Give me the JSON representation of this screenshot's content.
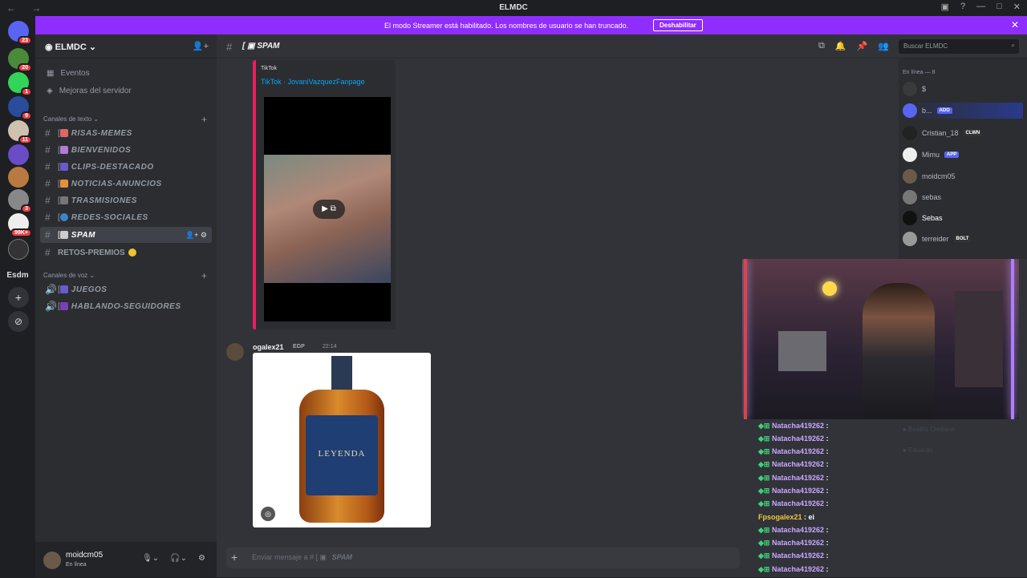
{
  "titlebar": {
    "title": "ELMDC"
  },
  "banner": {
    "text": "El modo Streamer está habilitado. Los nombres de usuario se han truncado.",
    "button": "Deshabilitar"
  },
  "servers": {
    "badges": [
      "23",
      "20",
      "1",
      "9",
      "11",
      "3",
      "99K+"
    ],
    "label": "Esdm"
  },
  "sidebar": {
    "guild_name": "ELMDC",
    "shortcuts": [
      "Eventos",
      "Mejoras del servidor"
    ],
    "text_category": "Canales de texto",
    "channels": [
      "RISAS-MEMES",
      "BIENVENIDOS",
      "CLIPS-DESTACADO",
      "NOTICIAS-ANUNCIOS",
      "TRASMISIONES",
      "REDES-SOCIALES",
      "SPAM",
      "RETOS-PREMIOS"
    ],
    "voice_category": "Canales de voz",
    "voice_channels": [
      "JUEGOS",
      "HABLANDO-SEGUIDORES"
    ]
  },
  "user": {
    "name": "moidcm05",
    "status": "En línea"
  },
  "channel": {
    "name": "SPAM",
    "search_placeholder": "Buscar ELMDC"
  },
  "embed": {
    "provider": "TikTok",
    "title": "TikTok · JovaniVazquezFanpage"
  },
  "message": {
    "author": "ogalex21",
    "tag": "EGP",
    "time": "22:14",
    "product_text": "LEYENDA"
  },
  "composer": {
    "placeholder": "Enviar mensaje a #",
    "channel": "SPAM"
  },
  "members": {
    "header": "En línea — 8",
    "list": [
      {
        "name": "$",
        "badge": ""
      },
      {
        "name": "b...",
        "badge": "ADO"
      },
      {
        "name": "Cristian_18",
        "badge": "CLWN"
      },
      {
        "name": "Mimu",
        "badge": "APP"
      },
      {
        "name": "moidcm05",
        "badge": ""
      },
      {
        "name": "sebas",
        "badge": ""
      },
      {
        "name": "Sebas",
        "badge": ""
      },
      {
        "name": "terreider",
        "badge": "BOLT"
      }
    ]
  },
  "chat": {
    "lines": [
      {
        "user": "Natacha419262",
        "text": ":"
      },
      {
        "user": "Natacha419262",
        "text": ":"
      },
      {
        "user": "Natacha419262",
        "text": ":"
      },
      {
        "user": "Natacha419262",
        "text": ":"
      },
      {
        "user": "Natacha419262",
        "text": ":"
      },
      {
        "user": "Natacha419262",
        "text": ":"
      },
      {
        "user": "Natacha419262",
        "text": ":"
      },
      {
        "user": "Fpsogalex21",
        "text": ": ei"
      },
      {
        "user": "Natacha419262",
        "text": ":"
      },
      {
        "user": "Natacha419262",
        "text": ":"
      },
      {
        "user": "Natacha419262",
        "text": ":"
      },
      {
        "user": "Natacha419262",
        "text": ":"
      }
    ]
  }
}
